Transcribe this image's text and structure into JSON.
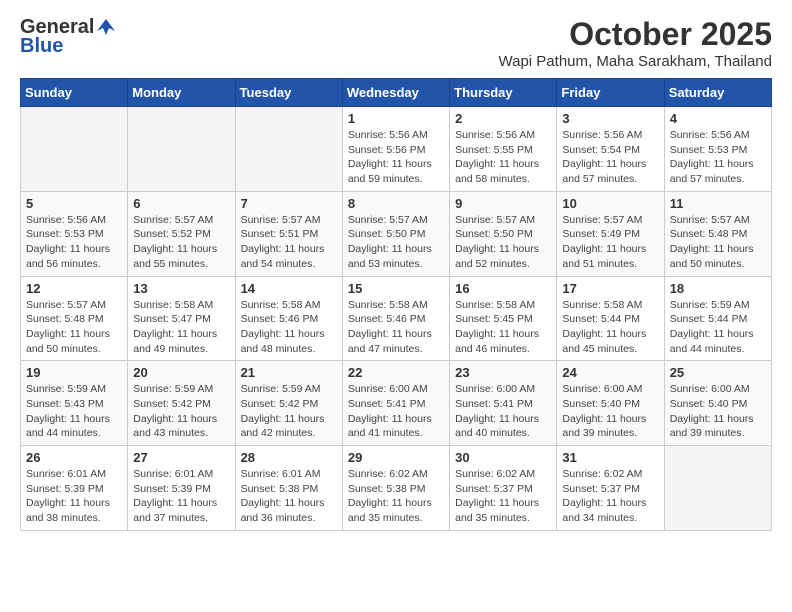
{
  "header": {
    "logo_general": "General",
    "logo_blue": "Blue",
    "month_title": "October 2025",
    "location": "Wapi Pathum, Maha Sarakham, Thailand"
  },
  "weekdays": [
    "Sunday",
    "Monday",
    "Tuesday",
    "Wednesday",
    "Thursday",
    "Friday",
    "Saturday"
  ],
  "weeks": [
    [
      {
        "day": "",
        "info": ""
      },
      {
        "day": "",
        "info": ""
      },
      {
        "day": "",
        "info": ""
      },
      {
        "day": "1",
        "info": "Sunrise: 5:56 AM\nSunset: 5:56 PM\nDaylight: 11 hours\nand 59 minutes."
      },
      {
        "day": "2",
        "info": "Sunrise: 5:56 AM\nSunset: 5:55 PM\nDaylight: 11 hours\nand 58 minutes."
      },
      {
        "day": "3",
        "info": "Sunrise: 5:56 AM\nSunset: 5:54 PM\nDaylight: 11 hours\nand 57 minutes."
      },
      {
        "day": "4",
        "info": "Sunrise: 5:56 AM\nSunset: 5:53 PM\nDaylight: 11 hours\nand 57 minutes."
      }
    ],
    [
      {
        "day": "5",
        "info": "Sunrise: 5:56 AM\nSunset: 5:53 PM\nDaylight: 11 hours\nand 56 minutes."
      },
      {
        "day": "6",
        "info": "Sunrise: 5:57 AM\nSunset: 5:52 PM\nDaylight: 11 hours\nand 55 minutes."
      },
      {
        "day": "7",
        "info": "Sunrise: 5:57 AM\nSunset: 5:51 PM\nDaylight: 11 hours\nand 54 minutes."
      },
      {
        "day": "8",
        "info": "Sunrise: 5:57 AM\nSunset: 5:50 PM\nDaylight: 11 hours\nand 53 minutes."
      },
      {
        "day": "9",
        "info": "Sunrise: 5:57 AM\nSunset: 5:50 PM\nDaylight: 11 hours\nand 52 minutes."
      },
      {
        "day": "10",
        "info": "Sunrise: 5:57 AM\nSunset: 5:49 PM\nDaylight: 11 hours\nand 51 minutes."
      },
      {
        "day": "11",
        "info": "Sunrise: 5:57 AM\nSunset: 5:48 PM\nDaylight: 11 hours\nand 50 minutes."
      }
    ],
    [
      {
        "day": "12",
        "info": "Sunrise: 5:57 AM\nSunset: 5:48 PM\nDaylight: 11 hours\nand 50 minutes."
      },
      {
        "day": "13",
        "info": "Sunrise: 5:58 AM\nSunset: 5:47 PM\nDaylight: 11 hours\nand 49 minutes."
      },
      {
        "day": "14",
        "info": "Sunrise: 5:58 AM\nSunset: 5:46 PM\nDaylight: 11 hours\nand 48 minutes."
      },
      {
        "day": "15",
        "info": "Sunrise: 5:58 AM\nSunset: 5:46 PM\nDaylight: 11 hours\nand 47 minutes."
      },
      {
        "day": "16",
        "info": "Sunrise: 5:58 AM\nSunset: 5:45 PM\nDaylight: 11 hours\nand 46 minutes."
      },
      {
        "day": "17",
        "info": "Sunrise: 5:58 AM\nSunset: 5:44 PM\nDaylight: 11 hours\nand 45 minutes."
      },
      {
        "day": "18",
        "info": "Sunrise: 5:59 AM\nSunset: 5:44 PM\nDaylight: 11 hours\nand 44 minutes."
      }
    ],
    [
      {
        "day": "19",
        "info": "Sunrise: 5:59 AM\nSunset: 5:43 PM\nDaylight: 11 hours\nand 44 minutes."
      },
      {
        "day": "20",
        "info": "Sunrise: 5:59 AM\nSunset: 5:42 PM\nDaylight: 11 hours\nand 43 minutes."
      },
      {
        "day": "21",
        "info": "Sunrise: 5:59 AM\nSunset: 5:42 PM\nDaylight: 11 hours\nand 42 minutes."
      },
      {
        "day": "22",
        "info": "Sunrise: 6:00 AM\nSunset: 5:41 PM\nDaylight: 11 hours\nand 41 minutes."
      },
      {
        "day": "23",
        "info": "Sunrise: 6:00 AM\nSunset: 5:41 PM\nDaylight: 11 hours\nand 40 minutes."
      },
      {
        "day": "24",
        "info": "Sunrise: 6:00 AM\nSunset: 5:40 PM\nDaylight: 11 hours\nand 39 minutes."
      },
      {
        "day": "25",
        "info": "Sunrise: 6:00 AM\nSunset: 5:40 PM\nDaylight: 11 hours\nand 39 minutes."
      }
    ],
    [
      {
        "day": "26",
        "info": "Sunrise: 6:01 AM\nSunset: 5:39 PM\nDaylight: 11 hours\nand 38 minutes."
      },
      {
        "day": "27",
        "info": "Sunrise: 6:01 AM\nSunset: 5:39 PM\nDaylight: 11 hours\nand 37 minutes."
      },
      {
        "day": "28",
        "info": "Sunrise: 6:01 AM\nSunset: 5:38 PM\nDaylight: 11 hours\nand 36 minutes."
      },
      {
        "day": "29",
        "info": "Sunrise: 6:02 AM\nSunset: 5:38 PM\nDaylight: 11 hours\nand 35 minutes."
      },
      {
        "day": "30",
        "info": "Sunrise: 6:02 AM\nSunset: 5:37 PM\nDaylight: 11 hours\nand 35 minutes."
      },
      {
        "day": "31",
        "info": "Sunrise: 6:02 AM\nSunset: 5:37 PM\nDaylight: 11 hours\nand 34 minutes."
      },
      {
        "day": "",
        "info": ""
      }
    ]
  ]
}
